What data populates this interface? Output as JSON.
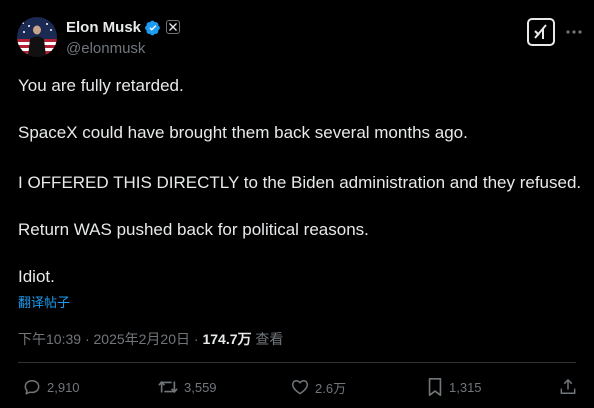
{
  "author": {
    "display_name": "Elon Musk",
    "handle": "@elonmusk",
    "verified": true
  },
  "tweet": {
    "lines": [
      "You are fully retarded.",
      "SpaceX could have brought them back several months ago.",
      "I OFFERED THIS DIRECTLY to the Biden administration and they refused.",
      "Return WAS pushed back for political reasons.",
      "Idiot."
    ],
    "translate_label": "翻译帖子"
  },
  "meta": {
    "time": "下午10:39",
    "date": "2025年2月20日",
    "separator": "·",
    "views_count": "174.7万",
    "views_label": "查看"
  },
  "actions": {
    "replies": "2,910",
    "reposts": "3,559",
    "likes": "2.6万",
    "bookmarks": "1,315"
  },
  "colors": {
    "background": "#000000",
    "text": "#e7e9ea",
    "secondary": "#71767b",
    "link": "#1d9bf0",
    "verified": "#1d9bf0",
    "divider": "#2f3336"
  },
  "icons": {
    "verified": "verified-badge-icon",
    "affiliate": "x-logo-icon",
    "grok": "grok-icon",
    "more": "more-dots-icon",
    "reply": "reply-bubble-icon",
    "repost": "repost-arrows-icon",
    "like": "heart-icon",
    "bookmark": "bookmark-icon",
    "share": "share-icon"
  }
}
